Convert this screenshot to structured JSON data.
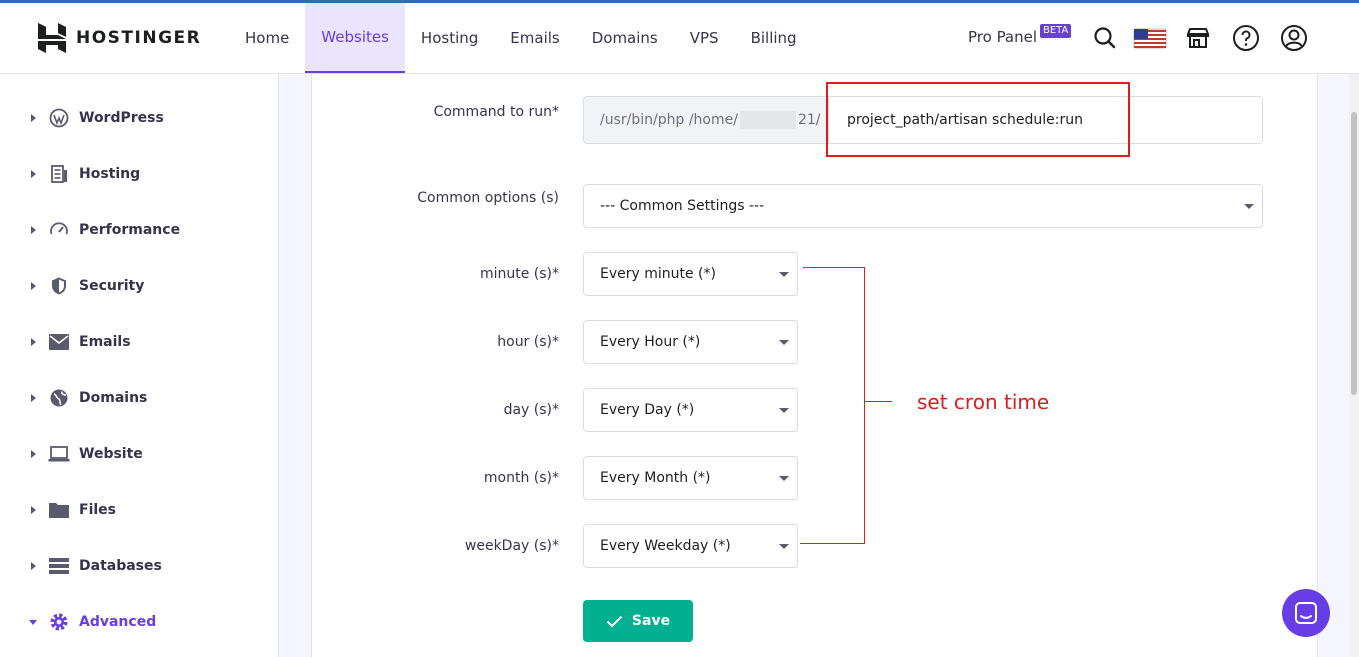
{
  "brand": {
    "name": "HOSTINGER"
  },
  "nav": {
    "items": [
      {
        "label": "Home",
        "active": false
      },
      {
        "label": "Websites",
        "active": true
      },
      {
        "label": "Hosting",
        "active": false
      },
      {
        "label": "Emails",
        "active": false
      },
      {
        "label": "Domains",
        "active": false
      },
      {
        "label": "VPS",
        "active": false
      },
      {
        "label": "Billing",
        "active": false
      }
    ],
    "pro_panel": "Pro Panel",
    "beta": "BETA"
  },
  "sidebar": {
    "items": [
      {
        "label": "WordPress",
        "icon": "wordpress-icon"
      },
      {
        "label": "Hosting",
        "icon": "server-icon"
      },
      {
        "label": "Performance",
        "icon": "gauge-icon"
      },
      {
        "label": "Security",
        "icon": "shield-icon"
      },
      {
        "label": "Emails",
        "icon": "envelope-icon"
      },
      {
        "label": "Domains",
        "icon": "globe-icon"
      },
      {
        "label": "Website",
        "icon": "laptop-icon"
      },
      {
        "label": "Files",
        "icon": "folder-icon"
      },
      {
        "label": "Databases",
        "icon": "database-icon"
      },
      {
        "label": "Advanced",
        "icon": "gear-icon",
        "active": true
      }
    ]
  },
  "form": {
    "command_label": "Command to run*",
    "command_prefix_start": "/usr/bin/php /home/",
    "command_prefix_end": "21/",
    "command_value": "project_path/artisan schedule:run",
    "common_label": "Common options (s)",
    "common_value": "--- Common Settings ---",
    "minute_label": "minute (s)*",
    "minute_value": "Every minute (*)",
    "hour_label": "hour (s)*",
    "hour_value": "Every Hour (*)",
    "day_label": "day (s)*",
    "day_value": "Every Day (*)",
    "month_label": "month (s)*",
    "month_value": "Every Month (*)",
    "weekday_label": "weekDay (s)*",
    "weekday_value": "Every Weekday (*)",
    "save_label": "Save"
  },
  "annotation": {
    "text": "set cron time",
    "color": "#e01b1b"
  },
  "colors": {
    "accent": "#673de6",
    "save": "#00b090"
  }
}
